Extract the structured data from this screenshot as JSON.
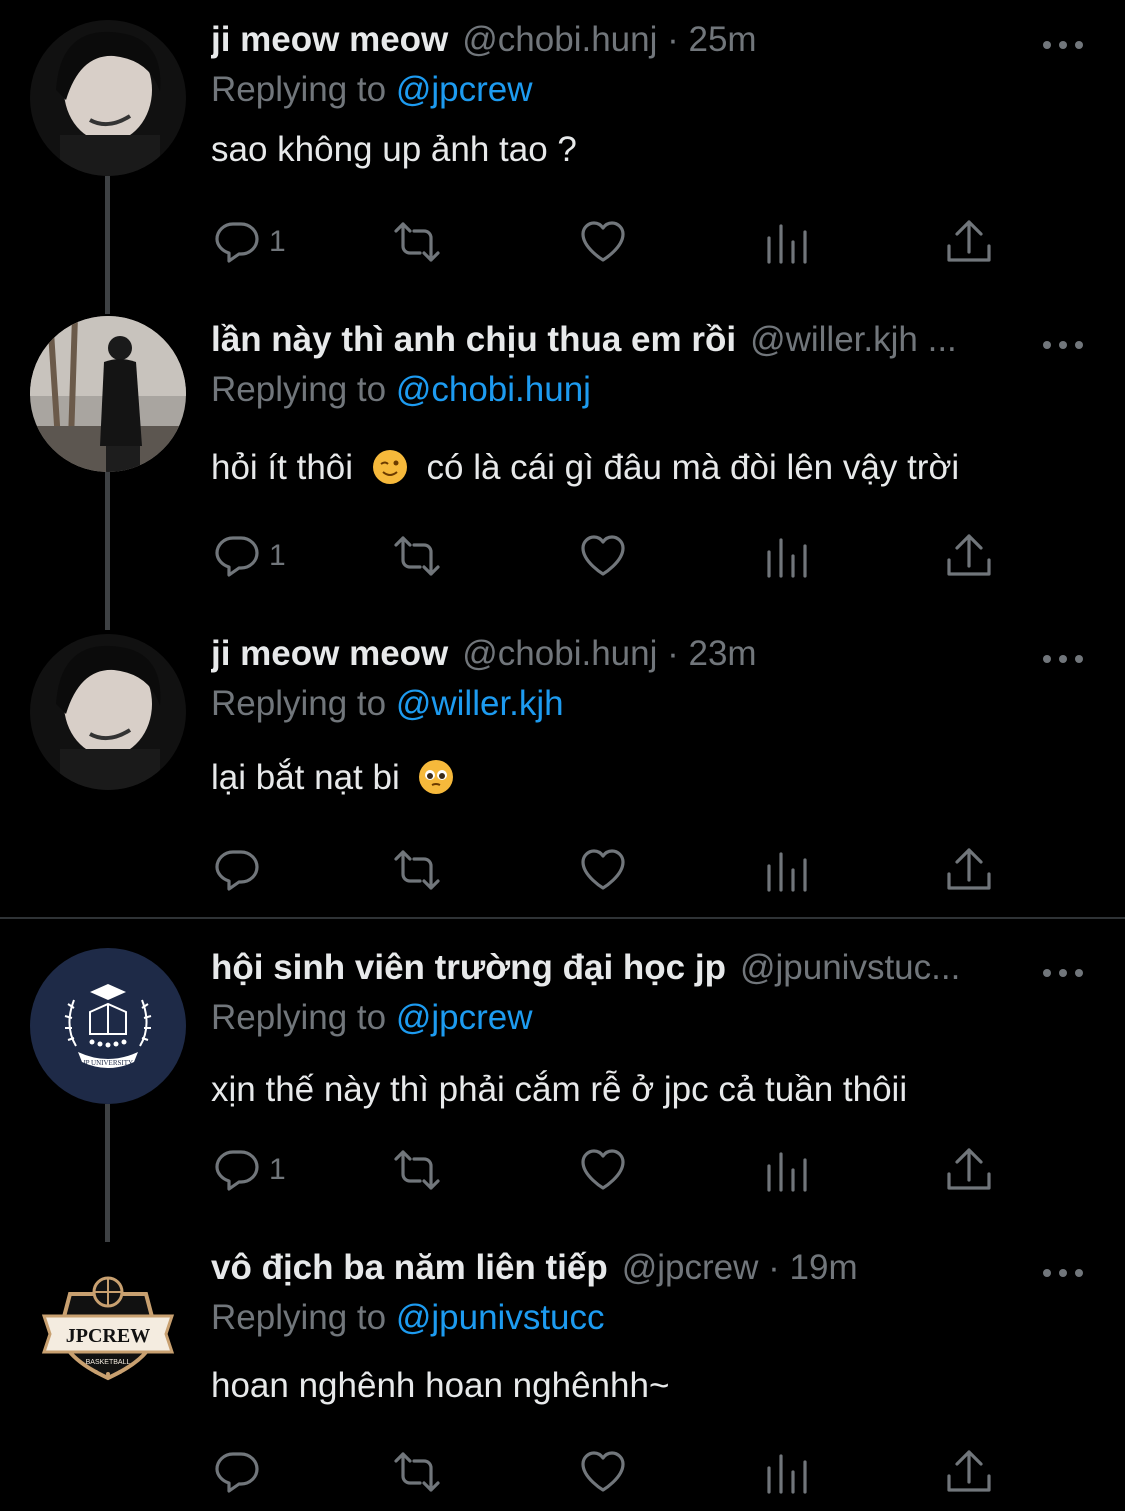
{
  "reply_label": "Replying to",
  "tweets": [
    {
      "name": "ji meow meow",
      "handle": "@chobi.hunj · 25m",
      "replying_to": "@jpcrew",
      "text": "sao không up ảnh tao ?",
      "reply_count": "1"
    },
    {
      "name": "lần này thì anh chịu thua em rồi",
      "handle": "@willer.kjh ...",
      "replying_to": "@chobi.hunj",
      "text_before": "hỏi ít thôi",
      "text_after": "có là cái gì đâu mà đòi lên vậy trời",
      "reply_count": "1"
    },
    {
      "name": "ji meow meow",
      "handle": "@chobi.hunj · 23m",
      "replying_to": "@willer.kjh",
      "text": "lại bắt nạt bi",
      "reply_count": ""
    },
    {
      "name": "hội sinh viên trường đại học jp",
      "handle": "@jpunivstuc...",
      "replying_to": "@jpcrew",
      "text": "xịn thế này thì phải cắm rễ ở jpc cả tuần thôii",
      "reply_count": "1"
    },
    {
      "name": "vô địch ba năm liên tiếp",
      "handle": "@jpcrew · 19m",
      "replying_to": "@jpunivstucc",
      "text": "hoan nghênh hoan nghênhh~",
      "reply_count": ""
    }
  ],
  "logos": {
    "jp_university": "JP UNIVERSITY",
    "jpcrew": "JPCREW",
    "jpcrew_sub": "BASKETBALL"
  },
  "colors": {
    "background": "#000000",
    "text": "#e7e9ea",
    "muted": "#71767b",
    "link": "#1d9bf0"
  }
}
